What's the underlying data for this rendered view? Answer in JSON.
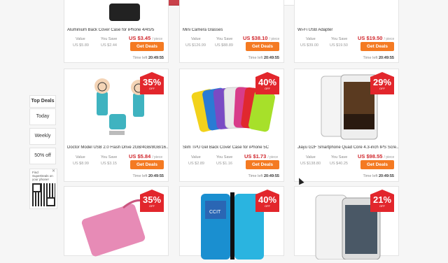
{
  "sidebar": {
    "title": "Top Deals",
    "items": [
      "Today",
      "Weekly",
      "50% off"
    ]
  },
  "qr": {
    "text": "Find SuperDeals on your phone!",
    "close": "✕"
  },
  "time_left_label": "Time left",
  "value_label": "Value",
  "save_label": "You Save",
  "per_label": "/ piece",
  "button_label": "Get Deals",
  "rows": [
    [
      {
        "title": "Aluminium Back Cover Case for iPhone 4/4S/5",
        "value": "US $5.89",
        "save": "US $2.44",
        "price": "US $3.45",
        "time": "20:49:55"
      },
      {
        "title": "Mini Camera Glasses",
        "value": "US $126.99",
        "save": "US $88.89",
        "price": "US $38.10",
        "time": "20:49:55"
      },
      {
        "title": "Wi-Fi USB Adapter",
        "value": "US $39.00",
        "save": "US $19.50",
        "price": "US $19.50",
        "time": "20:49:55"
      }
    ],
    [
      {
        "badge": "35%",
        "title": "Doctor Model USB 2.0 Flash Drive 2GB/4GB/8GB/16...",
        "value": "US $8.99",
        "save": "US $3.15",
        "price": "US $5.84",
        "time": "20:49:55"
      },
      {
        "badge": "40%",
        "title": "Slim TPU Gel Back Cover Case for iPhone 5C",
        "value": "US $2.89",
        "save": "US $1.16",
        "price": "US $1.73",
        "time": "20:49:55"
      },
      {
        "badge": "29%",
        "title": "Jiayu G2F Smartphone Quad Core 4.3-inch IPS Scre...",
        "value": "US $138.80",
        "save": "US $40.25",
        "price": "US $98.55",
        "time": "20:49:55"
      }
    ],
    [
      {
        "badge": "35%"
      },
      {
        "badge": "40%",
        "phone_text": "CCIT"
      },
      {
        "badge": "21%"
      }
    ]
  ],
  "badge_off": "OFF",
  "colors": {
    "badge": "#e2262c",
    "button": "#f47a22",
    "price": "#d0282e"
  }
}
